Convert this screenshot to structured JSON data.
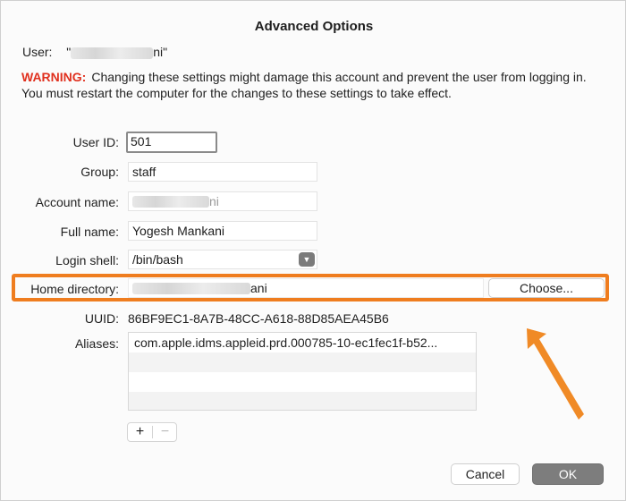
{
  "dialog": {
    "title": "Advanced Options"
  },
  "user": {
    "label": "User:",
    "open_quote": "\"",
    "name_suffix": "ni\""
  },
  "warning": {
    "label": "WARNING:",
    "text": "Changing these settings might damage this account and prevent the user from logging in. You must restart the computer for the changes to these settings to take effect."
  },
  "fields": {
    "user_id": {
      "label": "User ID:",
      "value": "501"
    },
    "group": {
      "label": "Group:",
      "value": "staff"
    },
    "account_name": {
      "label": "Account name:",
      "value_suffix": "ni"
    },
    "full_name": {
      "label": "Full name:",
      "value": "Yogesh Mankani"
    },
    "login_shell": {
      "label": "Login shell:",
      "value": "/bin/bash"
    },
    "home_directory": {
      "label": "Home directory:",
      "value_suffix": "ani",
      "choose_label": "Choose..."
    },
    "uuid": {
      "label": "UUID:",
      "value": "86BF9EC1-8A7B-48CC-A618-88D85AEA45B6"
    },
    "aliases": {
      "label": "Aliases:",
      "items": [
        "com.apple.idms.appleid.prd.000785-10-ec1fec1f-b52...",
        "",
        "",
        ""
      ]
    }
  },
  "list_controls": {
    "add": "+",
    "remove": "−"
  },
  "buttons": {
    "cancel": "Cancel",
    "ok": "OK"
  },
  "colors": {
    "warning": "#e0301e",
    "highlight": "#ef7d1f",
    "arrow": "#f08a26"
  }
}
